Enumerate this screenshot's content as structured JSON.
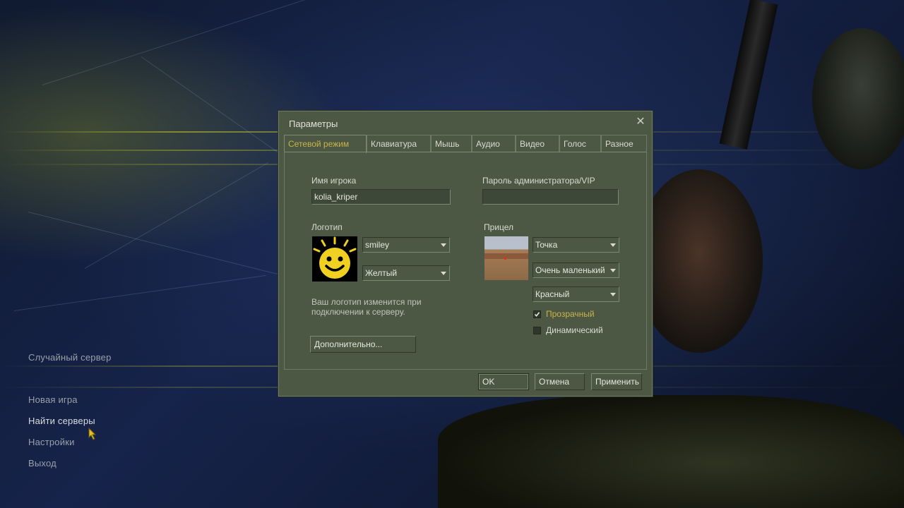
{
  "menu": {
    "items": [
      {
        "label": "Случайный сервер"
      },
      {
        "label": "Новая игра"
      },
      {
        "label": "Найти серверы"
      },
      {
        "label": "Настройки"
      },
      {
        "label": "Выход"
      }
    ]
  },
  "dialog": {
    "title": "Параметры",
    "tabs": [
      {
        "label": "Сетевой режим",
        "active": true
      },
      {
        "label": "Клавиатура"
      },
      {
        "label": "Мышь"
      },
      {
        "label": "Аудио"
      },
      {
        "label": "Видео"
      },
      {
        "label": "Голос"
      },
      {
        "label": "Разное"
      }
    ],
    "player_name_label": "Имя игрока",
    "player_name_value": "kolia_kriper",
    "admin_password_label": "Пароль администратора/VIP",
    "admin_password_value": "",
    "logo_label": "Логотип",
    "logo_select": "smiley",
    "logo_color_select": "Желтый",
    "logo_note": "Ваш логотип изменится при подключении к серверу.",
    "advanced_button": "Дополнительно...",
    "crosshair_label": "Прицел",
    "crosshair_type_select": "Точка",
    "crosshair_size_select": "Очень маленький",
    "crosshair_color_select": "Красный",
    "transparent_label": "Прозрачный",
    "transparent_checked": true,
    "dynamic_label": "Динамический",
    "dynamic_checked": false,
    "ok_button": "OK",
    "cancel_button": "Отмена",
    "apply_button": "Применить"
  },
  "colors": {
    "dialog_bg": "#4c5844",
    "accent_yellow": "#c8b449",
    "text": "#d7dbd0"
  }
}
